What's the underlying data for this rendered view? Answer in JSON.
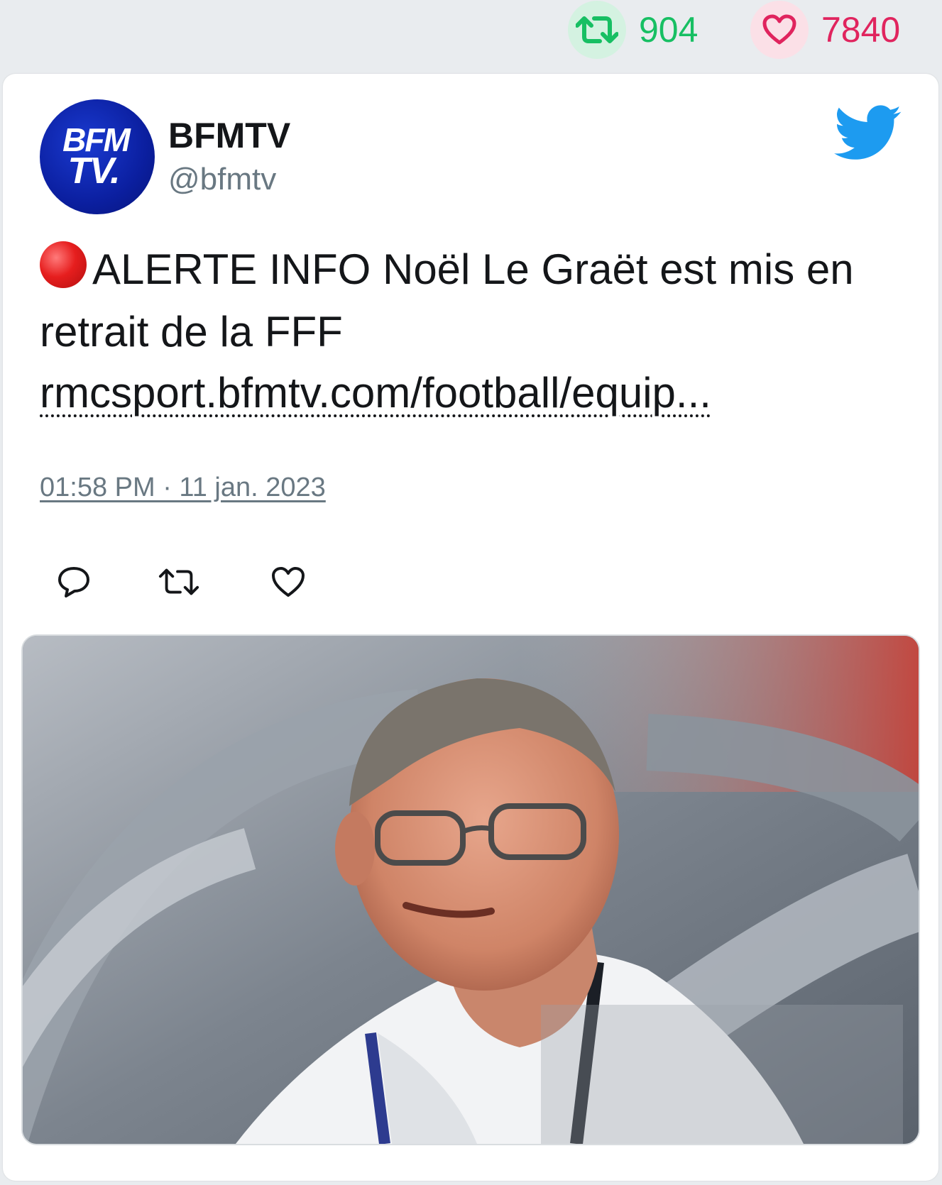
{
  "stats": {
    "retweet_count": "904",
    "like_count": "7840",
    "retweet_icon": "retweet-icon",
    "like_icon": "heart-icon"
  },
  "tweet": {
    "author": {
      "display_name": "BFMTV",
      "handle": "@bfmtv",
      "avatar_text_line1": "BFM",
      "avatar_text_line2": "TV."
    },
    "text": "ALERTE INFO Noël Le Graët est mis en retrait de la FFF",
    "link": "rmcsport.bfmtv.com/football/equip...",
    "timestamp": "01:58 PM · 11 jan. 2023",
    "actions": [
      "reply-icon",
      "retweet-icon",
      "like-icon"
    ],
    "image_alt": "photo of an elderly man with glasses in a stadium"
  },
  "colors": {
    "retweet_green": "#17bf63",
    "like_pink": "#e0245e",
    "twitter_blue": "#1d9bf0",
    "muted_text": "#697882",
    "page_bg": "#e9ecef"
  }
}
